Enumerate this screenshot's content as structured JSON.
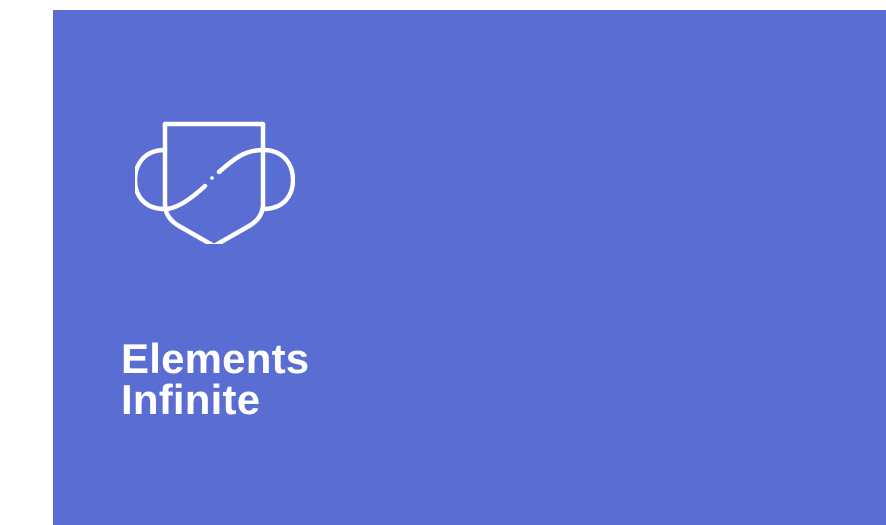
{
  "card": {
    "background": "#5a6dd3",
    "logo_icon": "shield-with-loops-icon",
    "title_line_1": "Elements",
    "title_line_2": "Infinite"
  }
}
